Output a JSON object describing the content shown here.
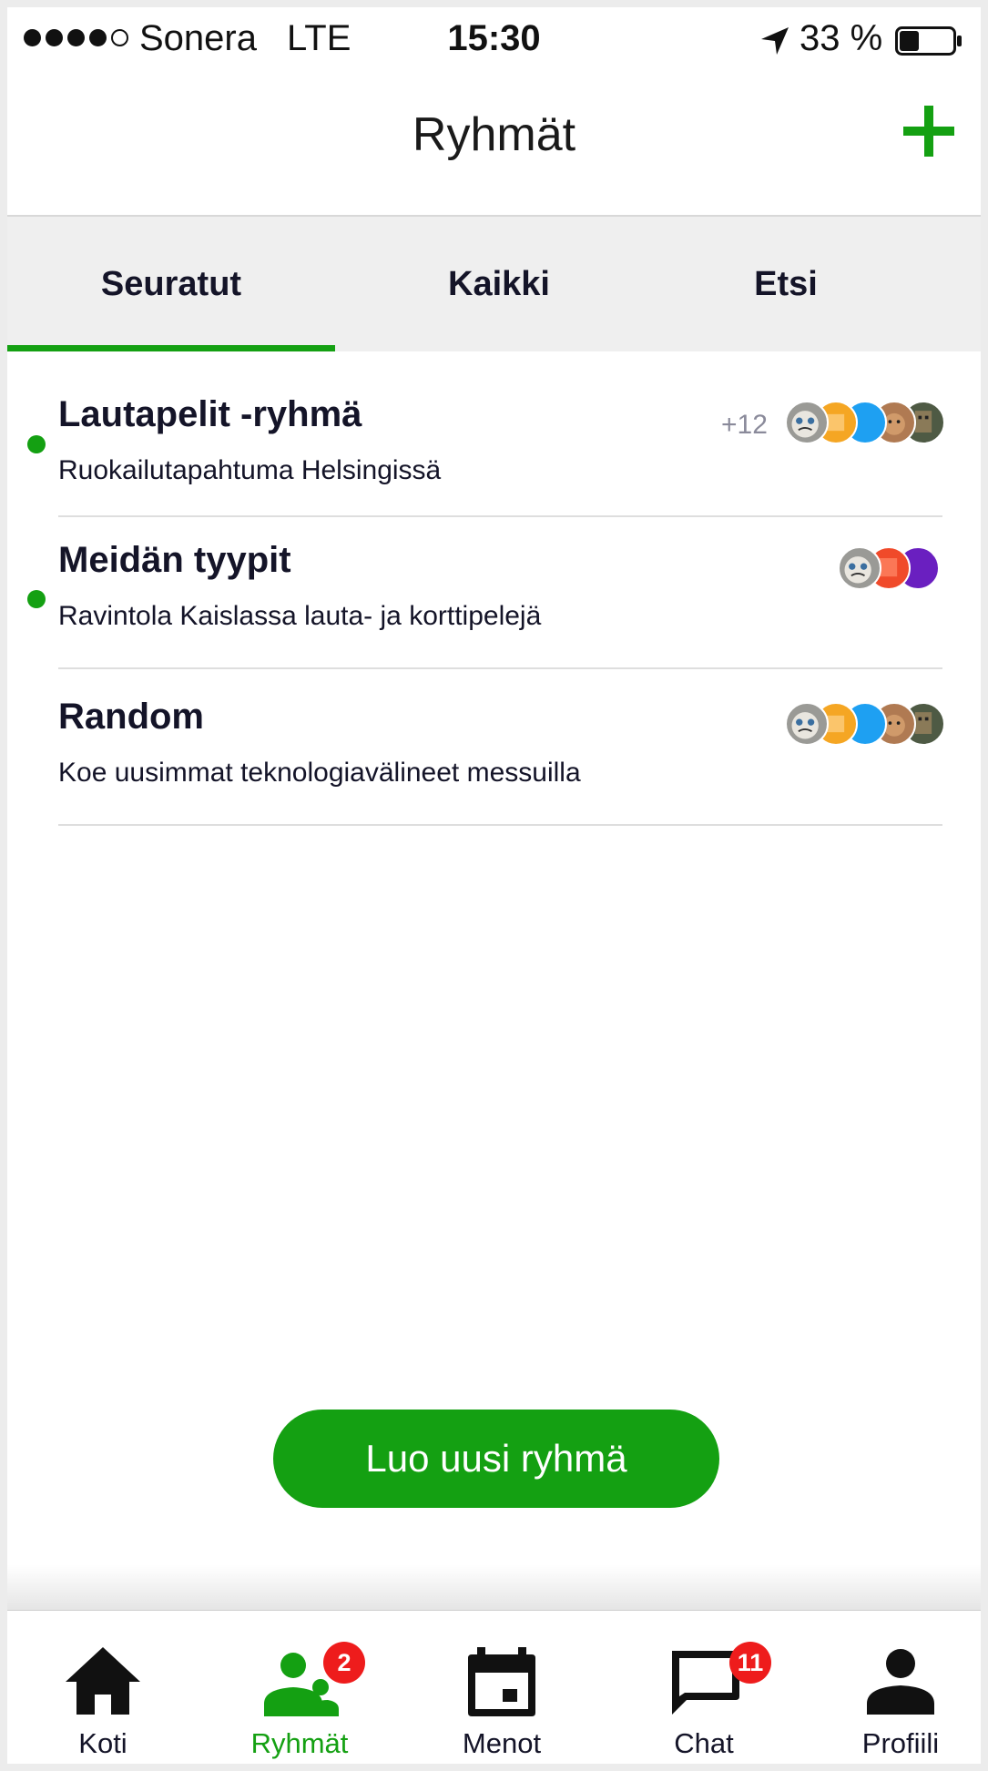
{
  "status_bar": {
    "carrier": "Sonera",
    "network": "LTE",
    "time": "15:30",
    "battery": "33 %",
    "signal_strength": 4,
    "signal_max": 5,
    "battery_level": 0.33
  },
  "header": {
    "title": "Ryhmät",
    "add_icon": "plus-icon"
  },
  "tabs": [
    {
      "label": "Seuratut",
      "active": true
    },
    {
      "label": "Kaikki",
      "active": false
    },
    {
      "label": "Etsi",
      "active": false
    }
  ],
  "groups": [
    {
      "name": "Lautapelit -ryhmä",
      "description": "Ruokailutapahtuma Helsingissä",
      "unread": true,
      "extra_members": "+12",
      "avatars": [
        "cat-avatar",
        "orange-avatar",
        "blue-avatar",
        "brown-avatar",
        "box-avatar"
      ]
    },
    {
      "name": "Meidän tyypit",
      "description": "Ravintola Kaislassa lauta- ja korttipelejä",
      "unread": true,
      "extra_members": "",
      "avatars": [
        "cat-avatar",
        "red-avatar",
        "purple-avatar"
      ]
    },
    {
      "name": "Random",
      "description": "Koe uusimmat teknologiavälineet messuilla",
      "unread": false,
      "extra_members": "",
      "avatars": [
        "cat-avatar",
        "orange-avatar",
        "blue-avatar",
        "brown-avatar",
        "box-avatar"
      ]
    }
  ],
  "create_button": "Luo uusi ryhmä",
  "bottom_nav": [
    {
      "label": "Koti",
      "icon": "home-icon",
      "badge": ""
    },
    {
      "label": "Ryhmät",
      "icon": "groups-icon",
      "badge": "2",
      "active": true
    },
    {
      "label": "Menot",
      "icon": "calendar-icon",
      "badge": ""
    },
    {
      "label": "Chat",
      "icon": "chat-icon",
      "badge": "11"
    },
    {
      "label": "Profiili",
      "icon": "profile-icon",
      "badge": ""
    }
  ],
  "colors": {
    "accent": "#14a012",
    "badge": "#ee1c1c",
    "text": "#141428",
    "tab_background": "#efefef"
  }
}
